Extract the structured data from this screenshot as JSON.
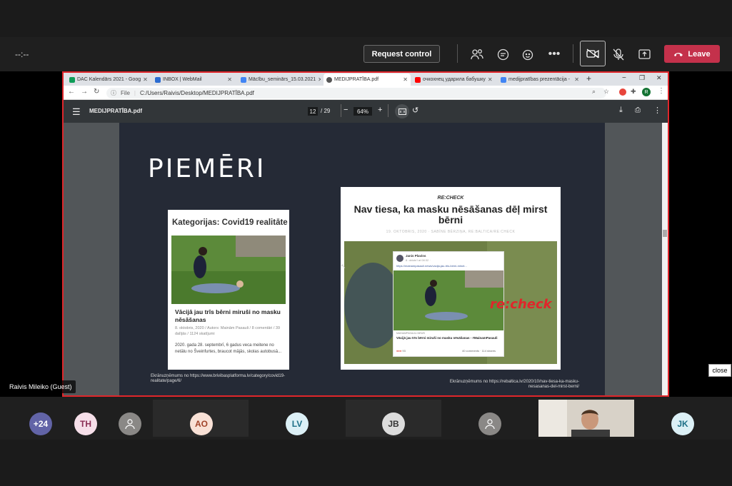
{
  "teams": {
    "timer": "--:--",
    "request_control": "Request control",
    "leave": "Leave",
    "presenter_name": "Raivis Mileiko (Guest)",
    "tooltip": "close",
    "colors": {
      "leave": "#c4314b",
      "share_border": "#e0262b"
    }
  },
  "browser": {
    "tabs": [
      {
        "label": "DAC Kalendārs 2021 - Goog",
        "icon": "sheets-icon",
        "color": "#0f9d58"
      },
      {
        "label": "INBOX | WebMail",
        "icon": "mail-icon",
        "color": "#2a6bd1"
      },
      {
        "label": "Mācību_seminārs_15.03.2021",
        "icon": "doc-icon",
        "color": "#4285f4"
      },
      {
        "label": "MEDIJPRATĪBA.pdf",
        "icon": "globe-icon",
        "color": "#555555"
      },
      {
        "label": "очкохнец ударила бабушку",
        "icon": "youtube-icon",
        "color": "#ff0000"
      },
      {
        "label": "medijpratības prezentācija -",
        "icon": "slides-icon",
        "color": "#4285f4"
      }
    ],
    "new_tab": "+",
    "address_prefix": "File",
    "address": "C:/Users/Raivis/Desktop/MEDIJPRATĪBA.pdf",
    "profile_initial": "R"
  },
  "pdf": {
    "title": "MEDIJPRATĪBA.pdf",
    "page_current": "12",
    "page_total": "/ 29",
    "zoom": "64%",
    "zoom_out": "−",
    "zoom_in": "+"
  },
  "slide": {
    "heading": "PIEMĒRI",
    "left_card": {
      "category": "Kategorijas: Covid19 realitāte",
      "headline": "Vācijā jau trīs bērni miruši no masku nēsāšanas",
      "meta": "8. oktobris, 2020 / Autors: Mainām Pasauli / 8 comentāri / 39 dalījās / 1124 skatījumi",
      "excerpt": "2020. gada 28. septembrī, 6 gadus veca meitene no netālu no Šveinfurtes, braucot mājās, skolas autobusā..."
    },
    "right_card": {
      "brand": "RE:CHECK",
      "headline": "Nav tiesa, ka masku nēsāšanas dēļ mirst bērni",
      "byline": "19. OKTOBRIS, 2020 · SABĪNE BĒRZIŅA, RE:BALTICA/RE:CHECK",
      "post_author": "Janis Plavins",
      "post_time": "8. oktobrī at 08:32 ·",
      "post_link": "https://mainampasauli.news/vacija-jau-tris-berni-miruti...",
      "post_source": "MAINAMPASAULI.NEWS",
      "post_text": "Vācijā jau trīs bērni miruši no masku nēsāšanas - #MainamPasauli",
      "reactions": "93",
      "comments": "40 comments · 114 shares",
      "stamp": "re:check"
    },
    "source_left": "Ekrānuzņēmums no https://www.brivibasplatforma.lv/category/covid19-realitate/page/6/",
    "source_right": "Ekrānuzņēmums no https://rebaltica.lv/2020/10/nav-tiesa-ka-masku-nesasanas-del-mirst-berni/"
  },
  "participants": [
    {
      "initials": "+24",
      "bg": "#6264a7",
      "fg": "#ffffff"
    },
    {
      "initials": "TH",
      "bg": "#f6dfe9",
      "fg": "#8b2e55"
    },
    {
      "initials": "",
      "bg": "#8a8886",
      "fg": "#ffffff",
      "icon": "person-icon"
    },
    {
      "initials": "AO",
      "bg": "#f9e1d6",
      "fg": "#a1442a"
    },
    {
      "initials": "LV",
      "bg": "#dcf0f6",
      "fg": "#1d6f87"
    },
    {
      "initials": "JB",
      "bg": "#dcdcdc",
      "fg": "#333333"
    },
    {
      "initials": "",
      "bg": "#8a8886",
      "fg": "#ffffff",
      "icon": "person-icon"
    },
    {
      "initials": "JK",
      "bg": "#dcf0f6",
      "fg": "#1d6f87"
    }
  ]
}
